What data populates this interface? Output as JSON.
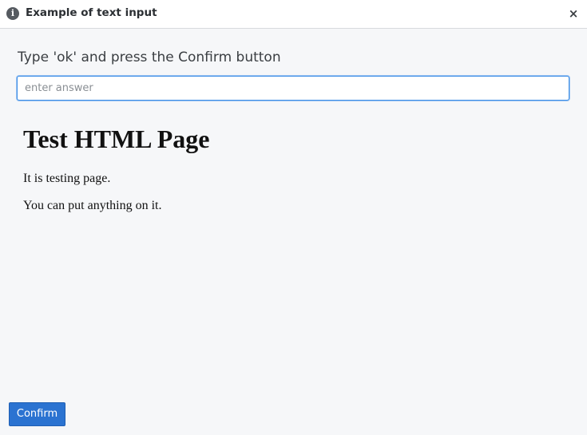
{
  "window": {
    "title": "Example of text input",
    "info_icon": "i",
    "close_icon": "×"
  },
  "form": {
    "prompt": "Type 'ok' and press the Confirm button",
    "input_value": "",
    "input_placeholder": "enter answer"
  },
  "page": {
    "heading": "Test HTML Page",
    "paragraphs": [
      "It is testing page.",
      "You can put anything on it."
    ]
  },
  "footer": {
    "confirm_label": "Confirm"
  },
  "colors": {
    "confirm_button": "#2b73d1",
    "input_focus_border": "#3d8ee6",
    "titlebar_bg": "#ffffff",
    "dialog_bg": "#f6f7f9"
  },
  "icons": {
    "info": "info-icon",
    "close": "close-icon"
  }
}
